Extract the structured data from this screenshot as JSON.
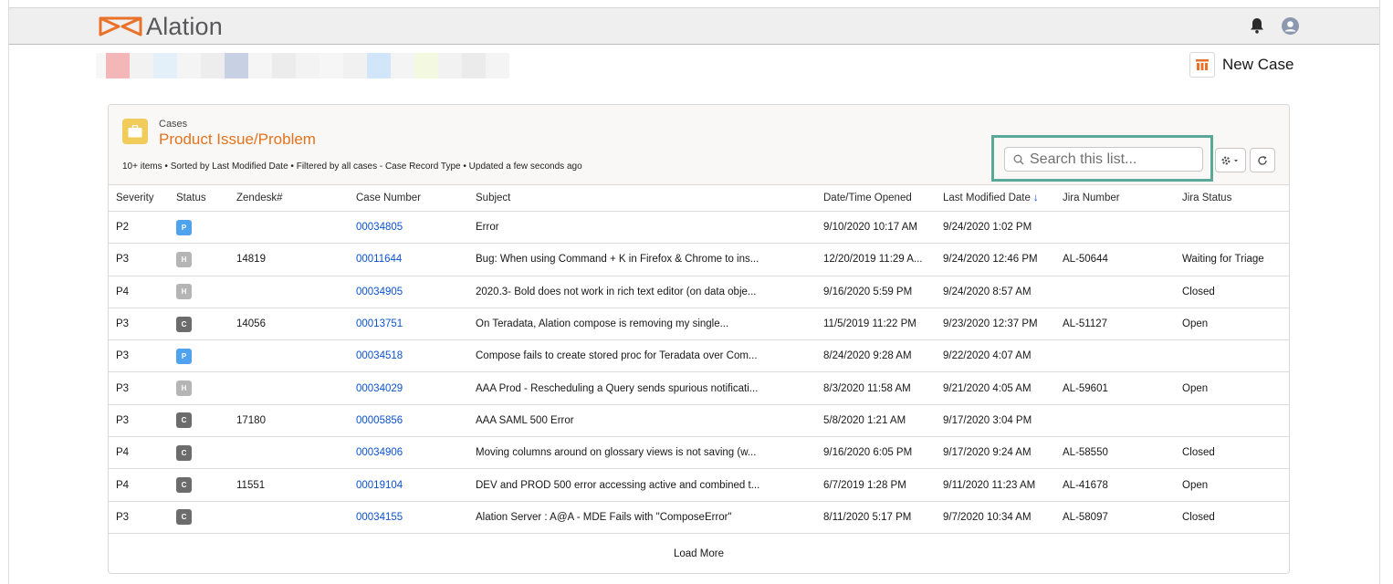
{
  "app": {
    "brand": "Alation",
    "colors": {
      "brand_orange": "#e8722a",
      "accent_green": "#5aa897",
      "link_blue": "#0b52d1"
    }
  },
  "header": {
    "new_case_label": "New Case"
  },
  "list": {
    "object_type": "Cases",
    "title": "Product Issue/Problem",
    "meta": "10+ items • Sorted by Last Modified Date • Filtered by all cases - Case Record Type • Updated a few seconds ago",
    "search_placeholder": "Search this list...",
    "columns": [
      "Severity",
      "Status",
      "Zendesk#",
      "Case Number",
      "Subject",
      "Date/Time Opened",
      "Last Modified Date",
      "Jira Number",
      "Jira Status"
    ],
    "sort_indicator": "↓",
    "rows": [
      {
        "severity": "P2",
        "status": "P",
        "zendesk": "",
        "case_number": "00034805",
        "subject": "Error",
        "opened": "9/10/2020 10:17 AM",
        "modified": "9/24/2020 1:02 PM",
        "jira_number": "",
        "jira_status": ""
      },
      {
        "severity": "P3",
        "status": "H",
        "zendesk": "14819",
        "case_number": "00011644",
        "subject": "Bug: When using Command + K in Firefox & Chrome to ins...",
        "opened": "12/20/2019 11:29 A...",
        "modified": "9/24/2020 12:46 PM",
        "jira_number": "AL-50644",
        "jira_status": "Waiting for Triage"
      },
      {
        "severity": "P4",
        "status": "H",
        "zendesk": "",
        "case_number": "00034905",
        "subject": "2020.3- Bold does not work in rich text editor (on data obje...",
        "opened": "9/16/2020 5:59 PM",
        "modified": "9/24/2020 8:57 AM",
        "jira_number": "",
        "jira_status": "Closed"
      },
      {
        "severity": "P3",
        "status": "C",
        "zendesk": "14056",
        "case_number": "00013751",
        "subject": "On Teradata, Alation compose is removing my single...",
        "opened": "11/5/2019 11:22 PM",
        "modified": "9/23/2020 12:37 PM",
        "jira_number": "AL-51127",
        "jira_status": "Open"
      },
      {
        "severity": "P3",
        "status": "P",
        "zendesk": "",
        "case_number": "00034518",
        "subject": "Compose fails to create stored proc for Teradata over Com...",
        "opened": "8/24/2020 9:28 AM",
        "modified": "9/22/2020 4:07 AM",
        "jira_number": "",
        "jira_status": ""
      },
      {
        "severity": "P3",
        "status": "H",
        "zendesk": "",
        "case_number": "00034029",
        "subject": "AAA Prod - Rescheduling a Query sends spurious notificati...",
        "opened": "8/3/2020 11:58 AM",
        "modified": "9/21/2020 4:05 AM",
        "jira_number": "AL-59601",
        "jira_status": "Open"
      },
      {
        "severity": "P3",
        "status": "C",
        "zendesk": "17180",
        "case_number": "00005856",
        "subject": "AAA SAML 500 Error",
        "opened": "5/8/2020 1:21 AM",
        "modified": "9/17/2020 3:04 PM",
        "jira_number": "",
        "jira_status": ""
      },
      {
        "severity": "P4",
        "status": "C",
        "zendesk": "",
        "case_number": "00034906",
        "subject": "Moving columns around on glossary views is not saving (w...",
        "opened": "9/16/2020 6:05 PM",
        "modified": "9/17/2020 9:24 AM",
        "jira_number": "AL-58550",
        "jira_status": "Closed"
      },
      {
        "severity": "P4",
        "status": "C",
        "zendesk": "11551",
        "case_number": "00019104",
        "subject": "DEV and PROD 500 error accessing active and combined t...",
        "opened": "6/7/2019 1:28 PM",
        "modified": "9/11/2020 11:23 AM",
        "jira_number": "AL-41678",
        "jira_status": "Open"
      },
      {
        "severity": "P3",
        "status": "C",
        "zendesk": "",
        "case_number": "00034155",
        "subject": "Alation Server : A@A - MDE Fails with \"ComposeError\"",
        "opened": "8/11/2020 5:17 PM",
        "modified": "9/7/2020 10:34 AM",
        "jira_number": "AL-58097",
        "jira_status": "Closed"
      }
    ],
    "load_more_label": "Load More"
  }
}
